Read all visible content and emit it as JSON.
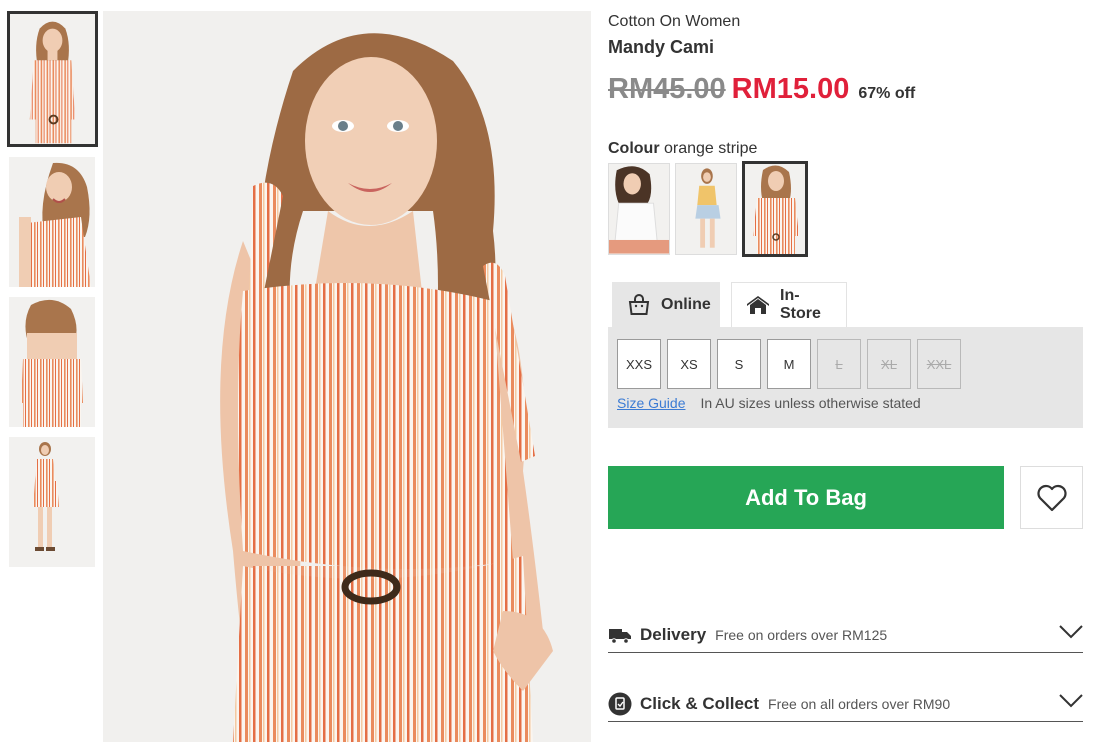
{
  "gallery": {
    "thumbnails": [
      {
        "name": "front-view",
        "active": true
      },
      {
        "name": "smiling-view",
        "active": false
      },
      {
        "name": "back-view",
        "active": false
      },
      {
        "name": "full-length-view",
        "active": false
      }
    ]
  },
  "product": {
    "brand": "Cotton On Women",
    "name": "Mandy Cami",
    "price_original": "RM45.00",
    "price_sale": "RM15.00",
    "discount": "67% off"
  },
  "colour": {
    "label": "Colour",
    "selected": "orange stripe",
    "swatches": [
      {
        "name": "white",
        "active": false
      },
      {
        "name": "yellow",
        "active": false
      },
      {
        "name": "orange stripe",
        "active": true
      }
    ]
  },
  "availability": {
    "tabs": [
      {
        "label": "Online",
        "icon": "shopping-bag-icon",
        "active": true
      },
      {
        "label": "In-Store",
        "icon": "store-icon",
        "active": false
      }
    ]
  },
  "sizes": {
    "options": [
      {
        "label": "XXS",
        "available": true
      },
      {
        "label": "XS",
        "available": true
      },
      {
        "label": "S",
        "available": true
      },
      {
        "label": "M",
        "available": true
      },
      {
        "label": "L",
        "available": false
      },
      {
        "label": "XL",
        "available": false
      },
      {
        "label": "XXL",
        "available": false
      }
    ],
    "guide_label": "Size Guide",
    "note": "In AU sizes unless otherwise stated"
  },
  "cta": {
    "add_label": "Add To Bag",
    "wishlist_icon": "heart-icon"
  },
  "info_sections": {
    "delivery": {
      "title": "Delivery",
      "subtitle": "Free on orders over RM125",
      "icon": "truck-icon"
    },
    "collect": {
      "title": "Click & Collect",
      "subtitle": "Free on all orders over RM90",
      "icon": "click-collect-icon"
    }
  },
  "colors": {
    "sale": "#e0203a",
    "add_button": "#26a656",
    "panel": "#e6e6e6",
    "link": "#3b7bd4",
    "stripe": "#e98a5e"
  }
}
